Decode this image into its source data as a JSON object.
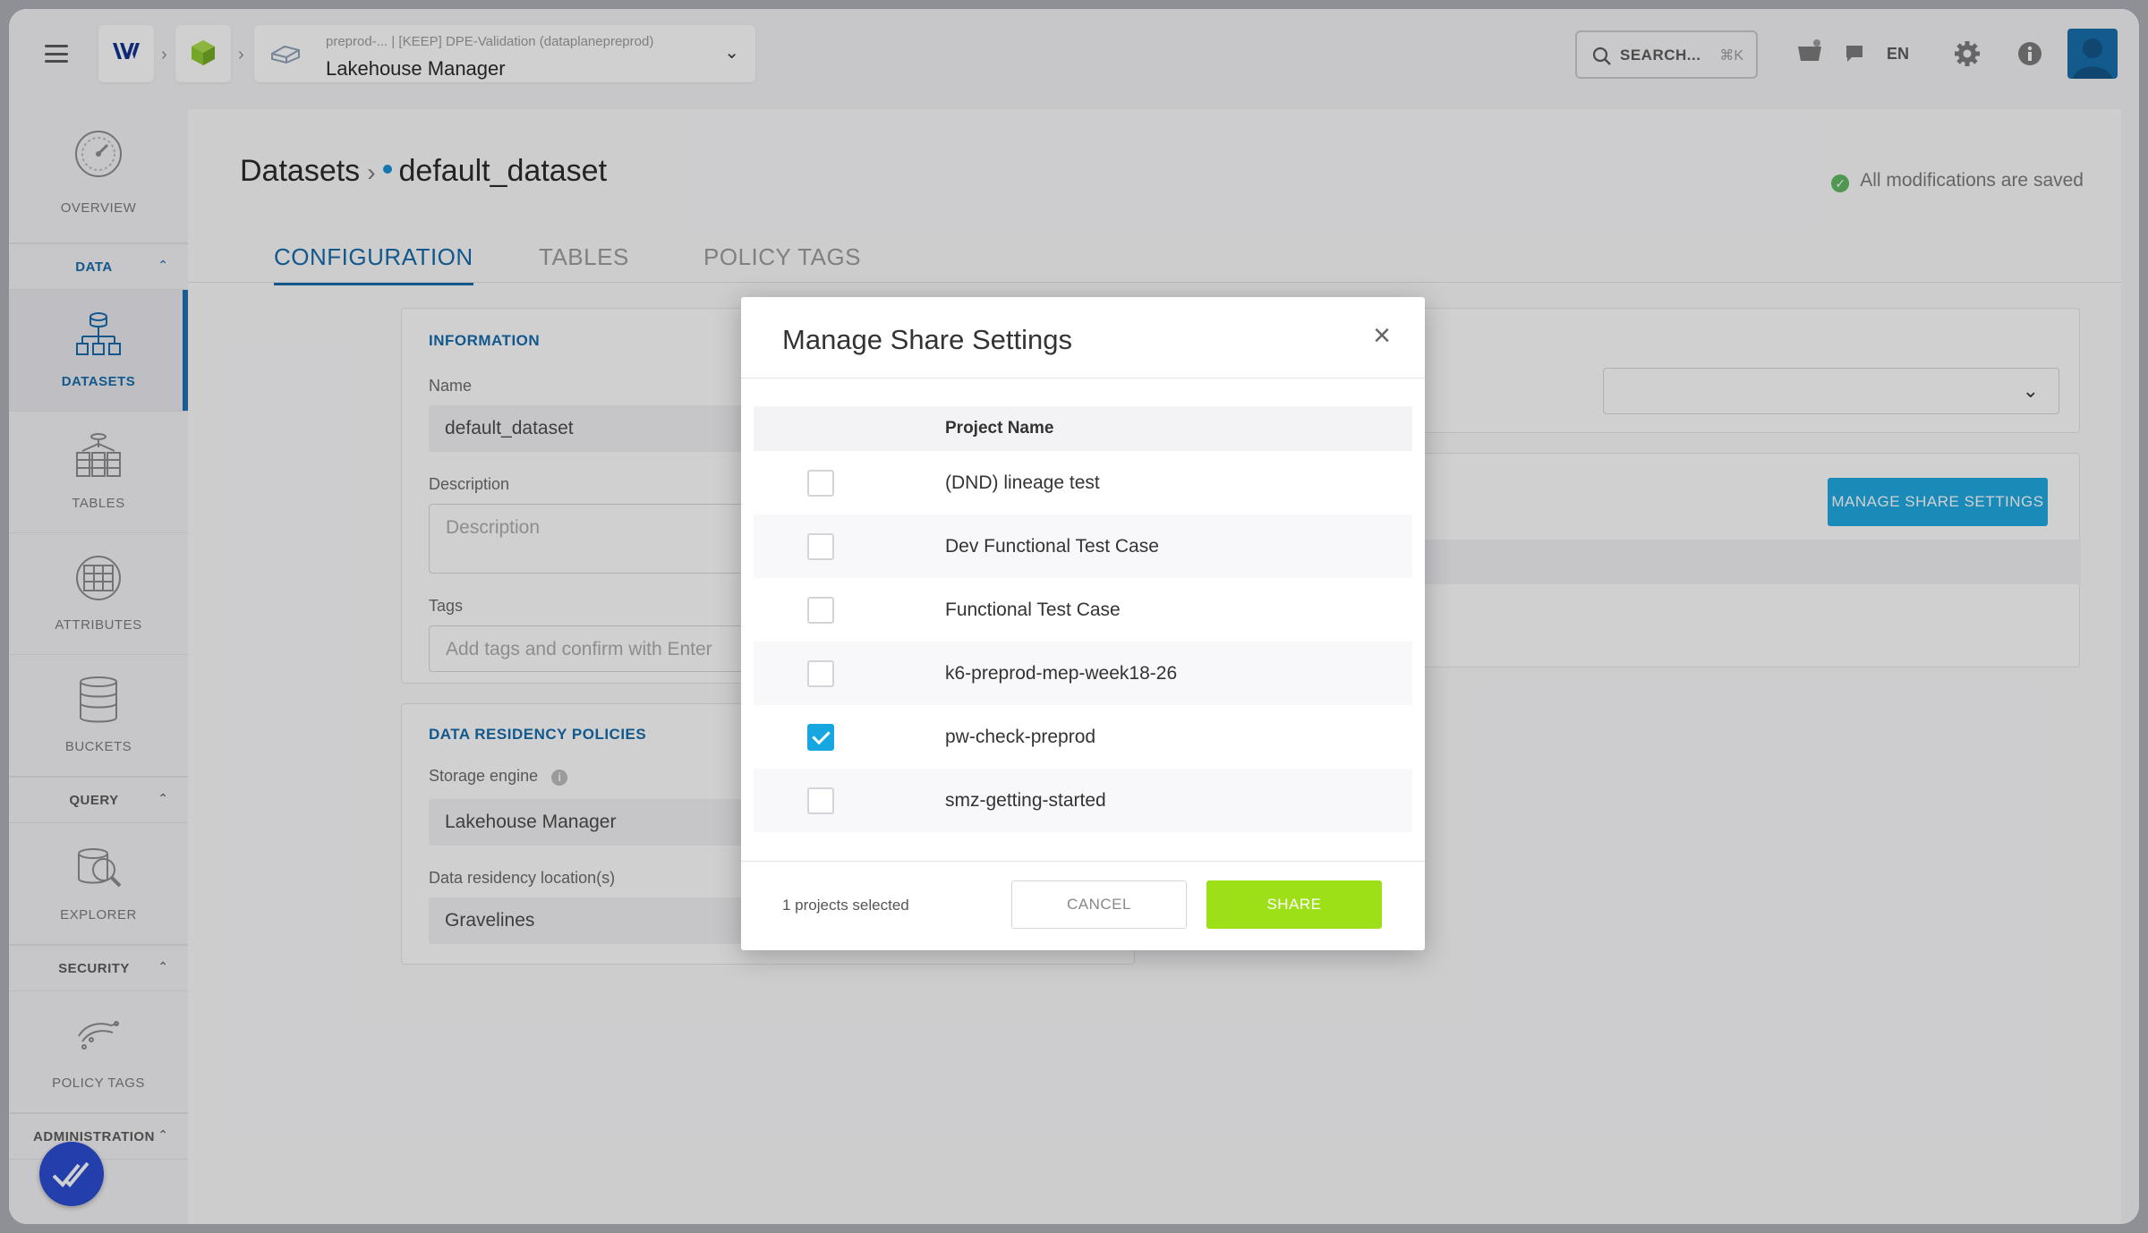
{
  "topbar": {
    "project_top": "preprod-...  |  [KEEP] DPE-Validation (dataplanepreprod)",
    "project_name": "Lakehouse Manager",
    "search_label": "SEARCH...",
    "search_shortcut": "⌘K",
    "language": "EN"
  },
  "sidebar": {
    "overview": "OVERVIEW",
    "sections": {
      "data": "DATA",
      "query": "QUERY",
      "security": "SECURITY",
      "administration": "ADMINISTRATION"
    },
    "items": {
      "datasets": "DATASETS",
      "tables": "TABLES",
      "attributes": "ATTRIBUTES",
      "buckets": "BUCKETS",
      "explorer": "EXPLORER",
      "policy_tags": "POLICY TAGS"
    }
  },
  "page": {
    "breadcrumb_root": "Datasets",
    "breadcrumb_current": "default_dataset",
    "saved_status": "All modifications are saved",
    "tabs": [
      "CONFIGURATION",
      "TABLES",
      "POLICY TAGS"
    ]
  },
  "information": {
    "title": "INFORMATION",
    "name_label": "Name",
    "name_value": "default_dataset",
    "description_label": "Description",
    "description_placeholder": "Description",
    "tags_label": "Tags",
    "tags_placeholder": "Add tags and confirm with Enter"
  },
  "residency": {
    "title": "DATA RESIDENCY POLICIES",
    "engine_label": "Storage engine",
    "engine_value": "Lakehouse Manager",
    "location_label": "Data residency location(s)",
    "location_value": "Gravelines"
  },
  "share_button_bg": "MANAGE SHARE SETTINGS",
  "modal": {
    "title": "Manage Share Settings",
    "column_header": "Project Name",
    "projects": [
      {
        "name": "(DND) lineage test",
        "checked": false
      },
      {
        "name": "Dev Functional Test Case",
        "checked": false
      },
      {
        "name": "Functional Test Case",
        "checked": false
      },
      {
        "name": "k6-preprod-mep-week18-26",
        "checked": false
      },
      {
        "name": "pw-check-preprod",
        "checked": true
      },
      {
        "name": "smz-getting-started",
        "checked": false
      }
    ],
    "selected_count": "1 projects selected",
    "cancel_label": "CANCEL",
    "share_label": "SHARE"
  },
  "colors": {
    "accent": "#0c66a8",
    "share_green": "#9ee018",
    "manage_blue": "#17a7e0"
  }
}
